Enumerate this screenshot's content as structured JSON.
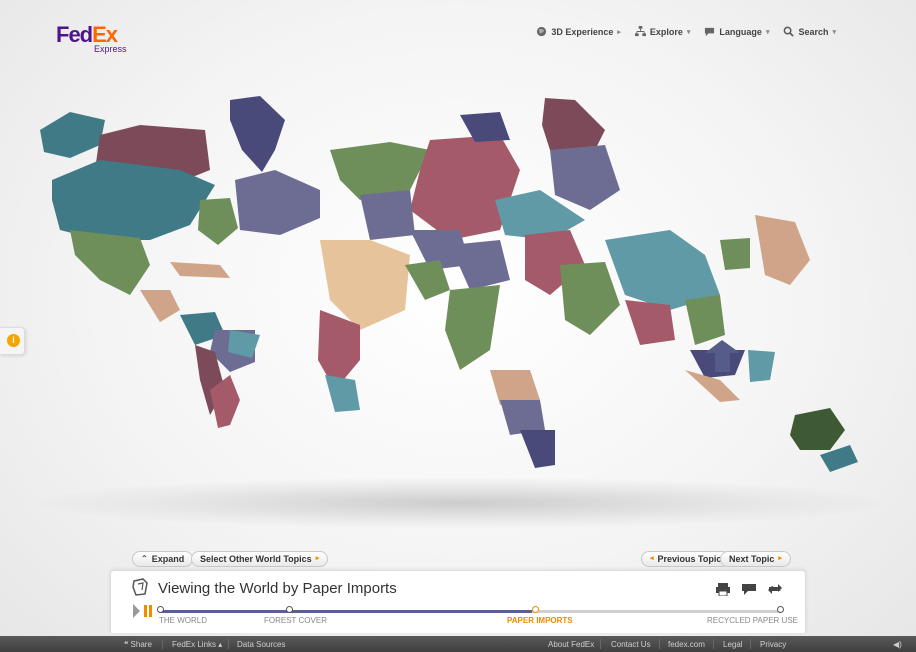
{
  "brand": {
    "fed": "Fed",
    "ex": "Ex",
    "sub": "Express"
  },
  "topnav": [
    {
      "label": "3D Experience",
      "icon": "globe-icon"
    },
    {
      "label": "Explore",
      "icon": "sitemap-icon"
    },
    {
      "label": "Language",
      "icon": "speech-bubble-icon"
    },
    {
      "label": "Search",
      "icon": "magnifier-icon"
    }
  ],
  "info": {
    "glyph": "i"
  },
  "controls": {
    "expand": "Expand",
    "select_topics": "Select Other World Topics",
    "previous": "Previous Topic",
    "next": "Next Topic"
  },
  "panel": {
    "title": "Viewing the World by Paper Imports"
  },
  "timeline": {
    "progress": 0.6,
    "stops": [
      {
        "label": "THE WORLD",
        "active": false
      },
      {
        "label": "FOREST COVER",
        "active": false
      },
      {
        "label": "PAPER IMPORTS",
        "active": true
      },
      {
        "label": "RECYCLED PAPER USE",
        "active": false
      }
    ]
  },
  "footer": {
    "share": "Share",
    "links": "FedEx Links",
    "sources": "Data Sources",
    "about": "About FedEx",
    "contact": "Contact Us",
    "site": "fedex.com",
    "legal": "Legal",
    "privacy": "Privacy"
  },
  "colors": {
    "purple": "#4d148c",
    "orange": "#ff6600",
    "accent": "#f08a00",
    "track": "#5b5f8f"
  }
}
